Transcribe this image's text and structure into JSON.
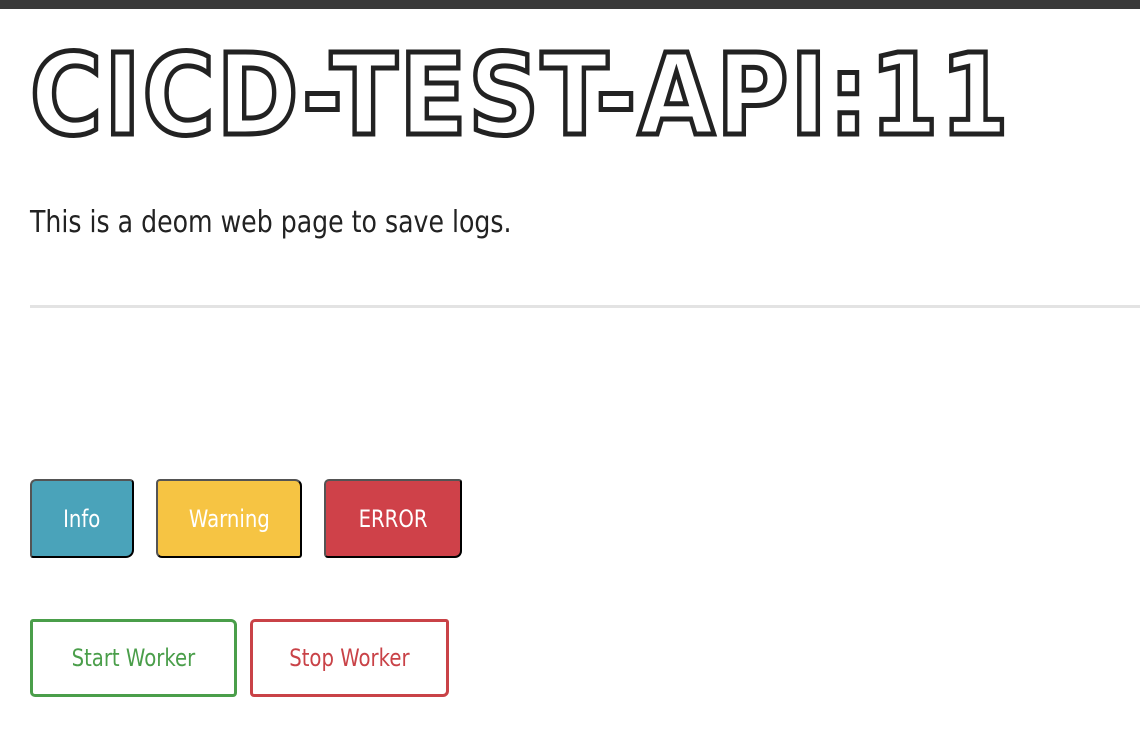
{
  "page": {
    "title": "CICD-TEST-API:11",
    "subtitle": "This is a deom web page to save logs."
  },
  "log_buttons": {
    "info_label": "Info",
    "warning_label": "Warning",
    "error_label": "ERROR"
  },
  "worker_buttons": {
    "start_label": "Start Worker",
    "stop_label": "Stop Worker"
  },
  "colors": {
    "info": "#4aa3ba",
    "warning": "#f6c443",
    "error": "#cf4149",
    "start": "#4a9e4a",
    "stop": "#c94247",
    "text": "#222222"
  }
}
